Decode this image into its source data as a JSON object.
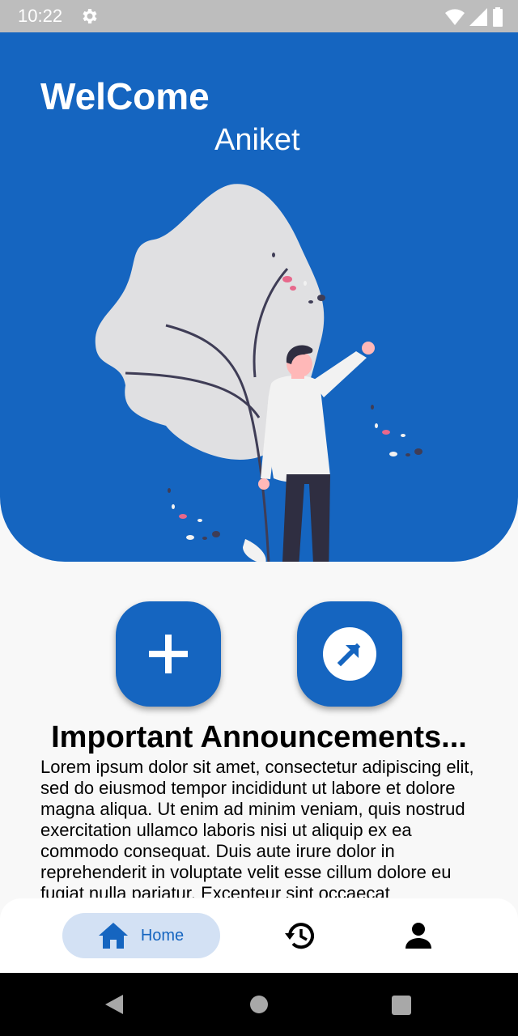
{
  "status_bar": {
    "time": "10:22"
  },
  "hero": {
    "title": "WelCome",
    "user_name": "Aniket"
  },
  "actions": {
    "add_icon": "plus-icon",
    "share_icon": "arrow-up-right-circle-icon"
  },
  "announcements": {
    "title": "Important Announcements...",
    "body": "Lorem ipsum dolor sit amet, consectetur adipiscing elit, sed do eiusmod tempor incididunt ut labore et dolore magna aliqua. Ut enim ad minim veniam, quis nostrud exercitation ullamco laboris nisi ut aliquip ex ea commodo consequat. Duis aute irure dolor in reprehenderit in voluptate velit esse cillum dolore eu fugiat nulla pariatur. Excepteur sint occaecat"
  },
  "bottom_nav": {
    "items": [
      {
        "label": "Home",
        "icon": "home-icon",
        "active": true
      },
      {
        "label": "",
        "icon": "history-icon",
        "active": false
      },
      {
        "label": "",
        "icon": "person-icon",
        "active": false
      }
    ]
  },
  "colors": {
    "primary": "#1565c0",
    "nav_active_bg": "#d3e1f4",
    "page_bg": "#f8f8f8"
  }
}
